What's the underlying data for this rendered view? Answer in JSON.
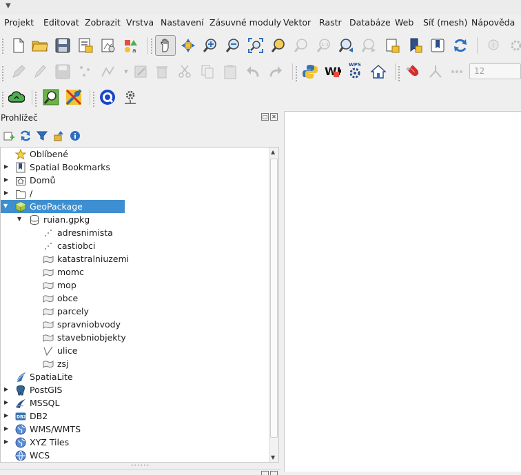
{
  "menubar": {
    "items": [
      "Projekt",
      "Editovat",
      "Zobrazit",
      "Vrstva",
      "Nastavení",
      "Zásuvné moduly",
      "Vektor",
      "Rastr",
      "Databáze",
      "Web",
      "Síť (mesh)",
      "Nápověda"
    ]
  },
  "toolbar": {
    "scale_value": "12",
    "wkt_label": "WKT",
    "wps_label": "WPS",
    "zoom_one_label": "1:1"
  },
  "browser": {
    "title": "Prohlížeč",
    "items": [
      {
        "label": "Oblíbené",
        "icon": "star-icon"
      },
      {
        "label": "Spatial Bookmarks",
        "icon": "bookmark-icon"
      },
      {
        "label": "Domů",
        "icon": "home-folder-icon"
      },
      {
        "label": "/",
        "icon": "folder-icon"
      },
      {
        "label": "GeoPackage",
        "icon": "geopackage-icon"
      },
      {
        "label": "ruian.gpkg",
        "icon": "database-icon"
      },
      {
        "label": "adresnimista",
        "icon": "point-layer-icon"
      },
      {
        "label": "castiobci",
        "icon": "point-layer-icon"
      },
      {
        "label": "katastralniuzemi",
        "icon": "polygon-layer-icon"
      },
      {
        "label": "momc",
        "icon": "polygon-layer-icon"
      },
      {
        "label": "mop",
        "icon": "polygon-layer-icon"
      },
      {
        "label": "obce",
        "icon": "polygon-layer-icon"
      },
      {
        "label": "parcely",
        "icon": "polygon-layer-icon"
      },
      {
        "label": "spravniobvody",
        "icon": "polygon-layer-icon"
      },
      {
        "label": "stavebniobjekty",
        "icon": "polygon-layer-icon"
      },
      {
        "label": "ulice",
        "icon": "line-layer-icon"
      },
      {
        "label": "zsj",
        "icon": "polygon-layer-icon"
      },
      {
        "label": "SpatiaLite",
        "icon": "spatialite-icon"
      },
      {
        "label": "PostGIS",
        "icon": "postgis-icon"
      },
      {
        "label": "MSSQL",
        "icon": "mssql-icon"
      },
      {
        "label": "DB2",
        "icon": "db2-icon"
      },
      {
        "label": "WMS/WMTS",
        "icon": "globe-icon"
      },
      {
        "label": "XYZ Tiles",
        "icon": "globe-icon"
      },
      {
        "label": "WCS",
        "icon": "globe-icon"
      }
    ],
    "db2_badge": "DB2"
  },
  "colors": {
    "selection": "#3d8fd1",
    "accent_green": "#4caf50",
    "accent_yellow": "#f2c230"
  }
}
